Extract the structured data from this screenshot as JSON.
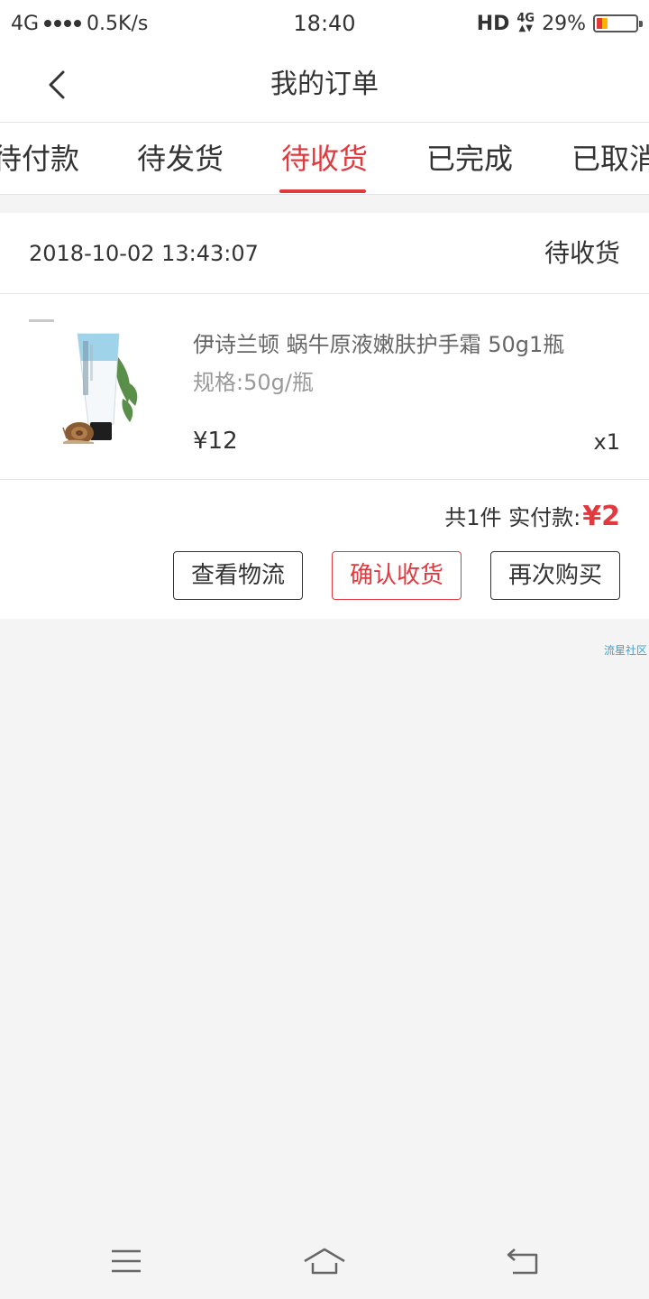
{
  "status_bar": {
    "network": "4G",
    "speed": "0.5K/s",
    "time": "18:40",
    "hd": "HD",
    "network_right": "4G",
    "battery": "29%"
  },
  "nav": {
    "title": "我的订单",
    "back_icon": "chevron-left-icon"
  },
  "tabs": [
    {
      "label": "待付款",
      "active": false
    },
    {
      "label": "待发货",
      "active": false
    },
    {
      "label": "待收货",
      "active": true
    },
    {
      "label": "已完成",
      "active": false
    },
    {
      "label": "已取消",
      "active": false
    }
  ],
  "order": {
    "time": "2018-10-02 13:43:07",
    "status": "待收货",
    "item": {
      "name": "伊诗兰顿 蜗牛原液嫩肤护手霜 50g1瓶",
      "spec": "规格:50g/瓶",
      "price": "¥12",
      "qty": "x1"
    },
    "summary_prefix": "共1件 实付款:",
    "total": "¥2",
    "buttons": {
      "logistics": "查看物流",
      "confirm": "确认收货",
      "rebuy": "再次购买"
    }
  },
  "watermark": "流星社区",
  "colors": {
    "accent": "#e0393e",
    "background": "#f4f4f4"
  }
}
